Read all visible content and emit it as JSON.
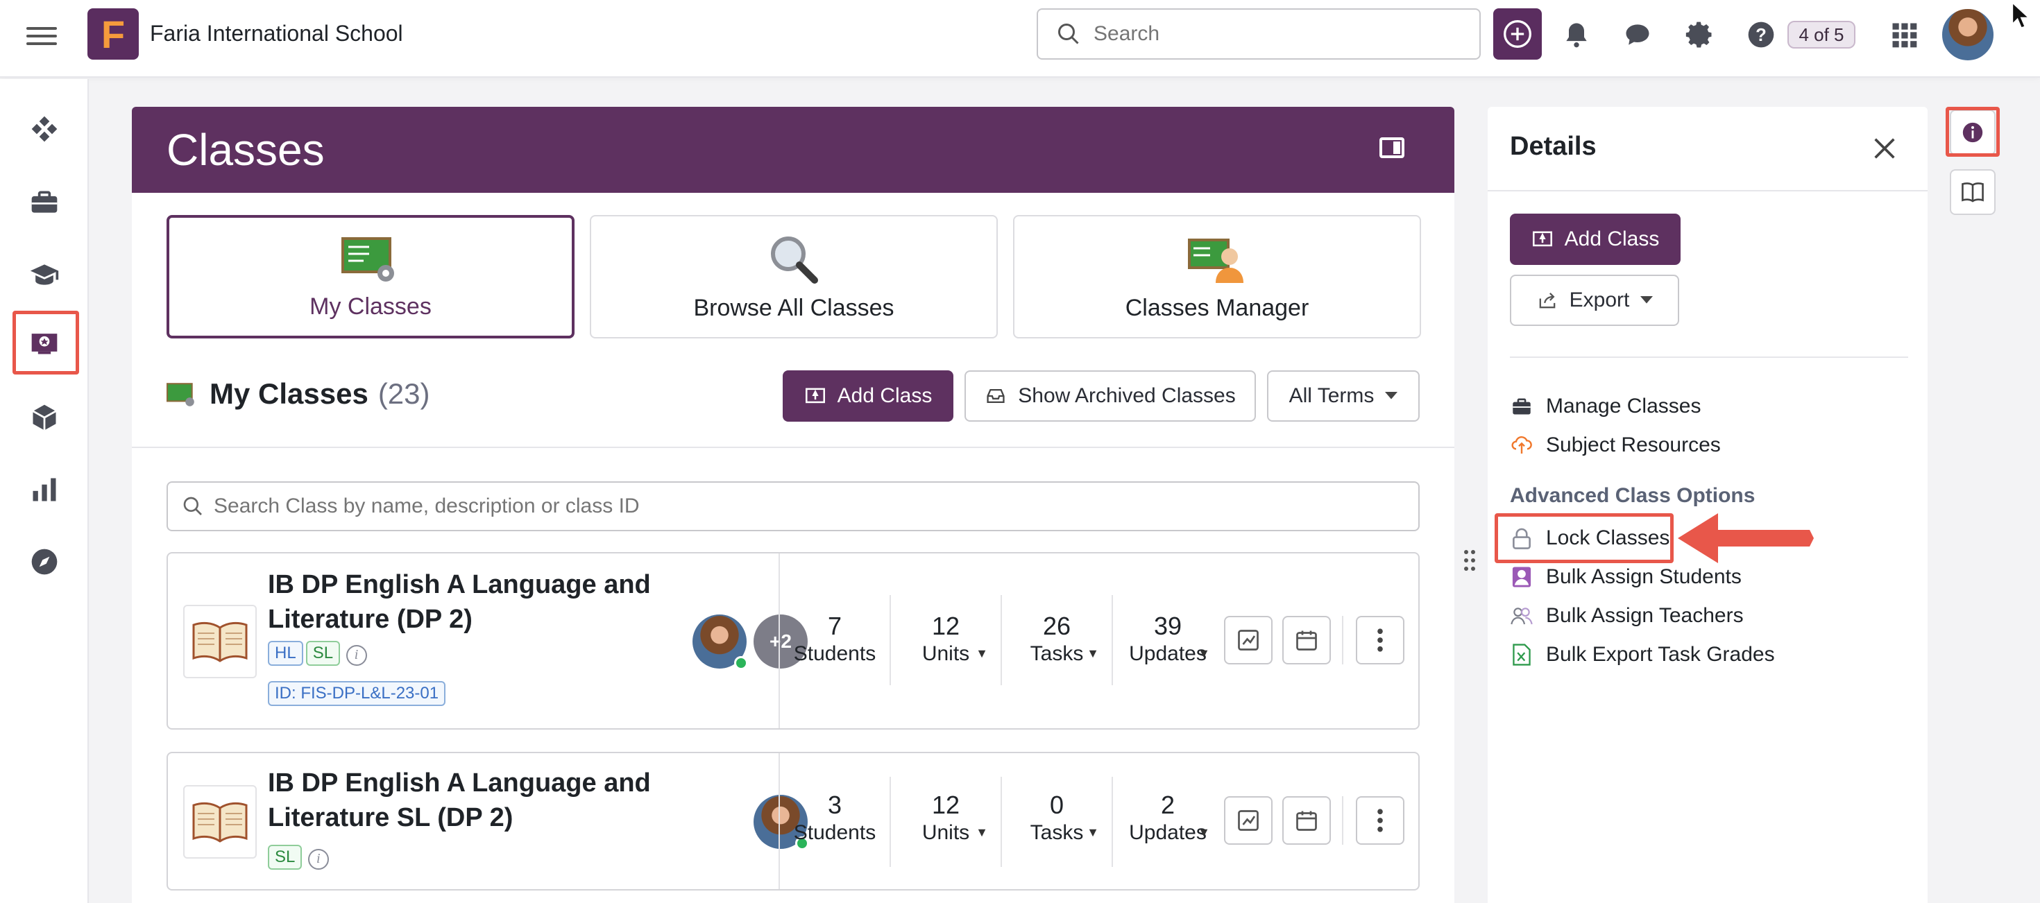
{
  "topbar": {
    "school_name": "Faria International School",
    "logo_letter": "F",
    "search_placeholder": "Search",
    "badge": "4 of 5"
  },
  "main": {
    "title": "Classes",
    "tabs": [
      {
        "label": "My Classes"
      },
      {
        "label": "Browse All Classes"
      },
      {
        "label": "Classes Manager"
      }
    ],
    "section_title": "My Classes",
    "section_count": "(23)",
    "add_class": "Add Class",
    "show_archived": "Show Archived Classes",
    "terms": "All Terms",
    "class_search_placeholder": "Search Class by name, description or class ID",
    "classes": [
      {
        "name": "IB DP English A Language and Literature (DP 2)",
        "tags": [
          "HL",
          "SL"
        ],
        "class_id": "ID: FIS-DP-L&L-23-01",
        "extra_teachers": "+2",
        "students": "7",
        "students_label": "Students",
        "units": "12",
        "units_label": "Units",
        "tasks": "26",
        "tasks_label": "Tasks",
        "updates": "39",
        "updates_label": "Updates"
      },
      {
        "name": "IB DP English A Language and Literature SL (DP 2)",
        "tags": [
          "SL"
        ],
        "students": "3",
        "students_label": "Students",
        "units": "12",
        "units_label": "Units",
        "tasks": "0",
        "tasks_label": "Tasks",
        "updates": "2",
        "updates_label": "Updates"
      }
    ]
  },
  "details": {
    "title": "Details",
    "add_class": "Add Class",
    "export": "Export",
    "links": [
      "Manage Classes",
      "Subject Resources"
    ],
    "advanced_title": "Advanced Class Options",
    "advanced_links": [
      "Lock Classes",
      "Bulk Assign Students",
      "Bulk Assign Teachers",
      "Bulk Export Task Grades"
    ]
  },
  "colors": {
    "brand": "#5e3160",
    "highlight": "#e8574a"
  }
}
